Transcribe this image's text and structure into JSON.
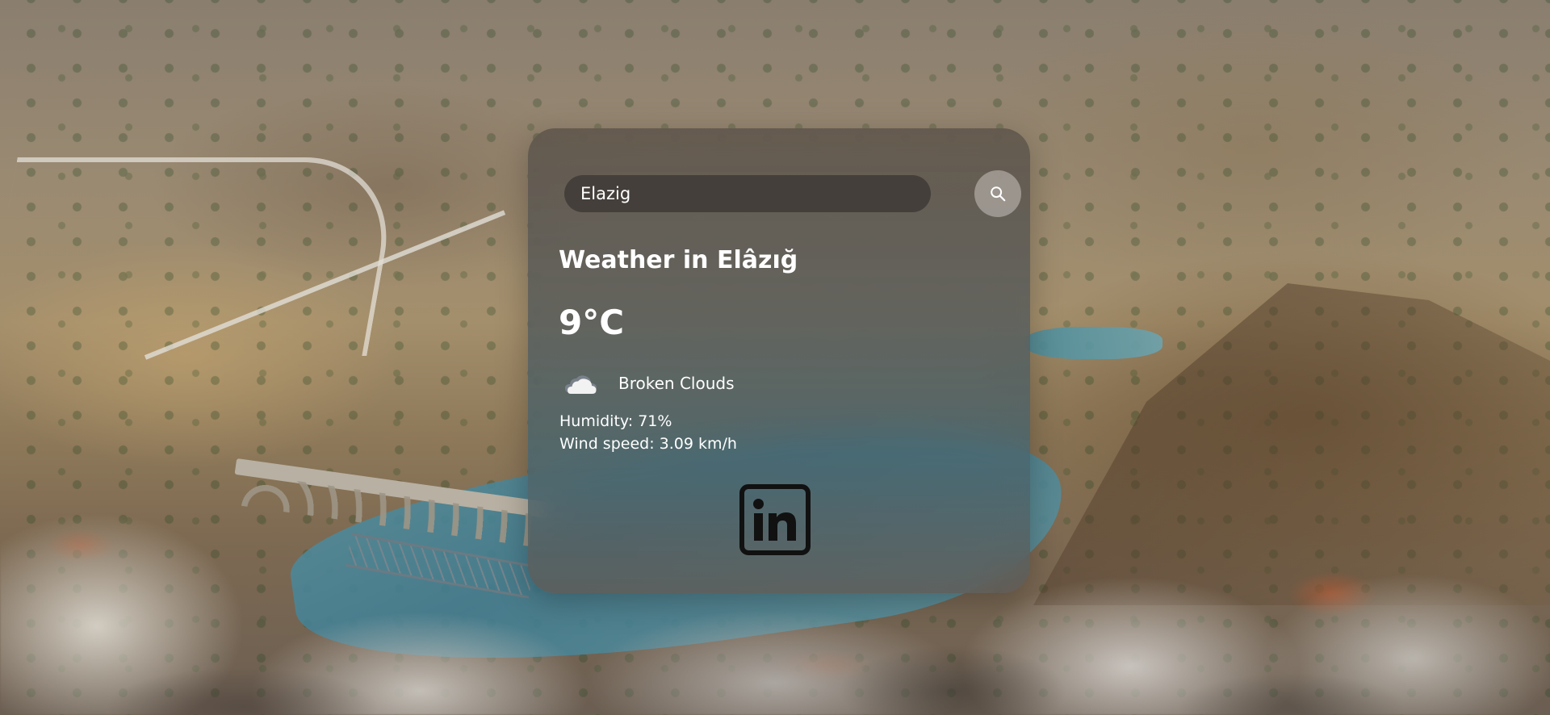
{
  "search": {
    "value": "Elazig",
    "button_icon": "search-icon"
  },
  "weather": {
    "title": "Weather in Elâzığ",
    "temperature": "9°C",
    "icon": "cloud-icon",
    "description": "Broken Clouds",
    "humidity": "Humidity: 71%",
    "wind": "Wind speed: 3.09 km/h"
  },
  "social": {
    "icon": "linkedin-icon"
  },
  "colors": {
    "text": "#ffffff",
    "card_top": "#5f554b",
    "card_mid": "#46646e",
    "input_bg": "#3c3734"
  }
}
